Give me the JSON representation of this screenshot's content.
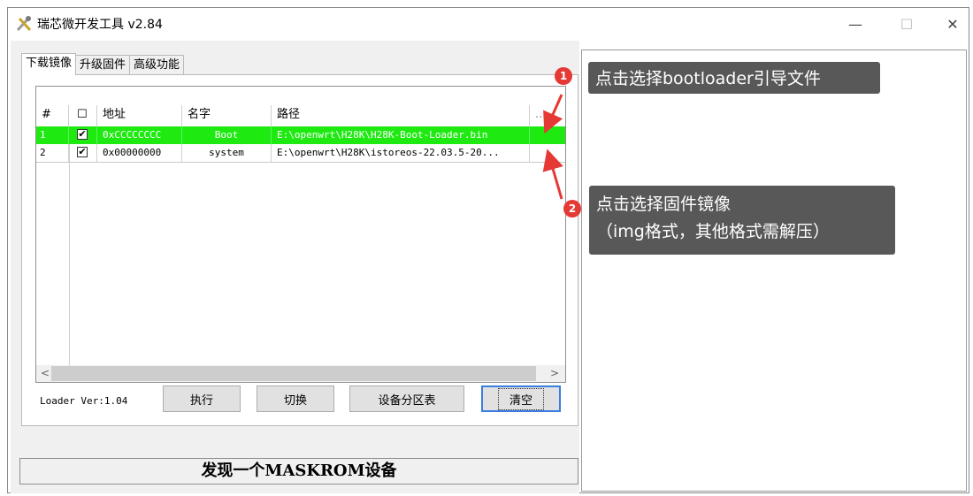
{
  "window": {
    "title": "瑞芯微开发工具 v2.84",
    "minimize": "—",
    "maximize": "☐",
    "close": "✕"
  },
  "tabs": [
    {
      "label": "下载镜像",
      "active": true
    },
    {
      "label": "升级固件",
      "active": false
    },
    {
      "label": "高级功能",
      "active": false
    }
  ],
  "table": {
    "headers": [
      "#",
      "☐",
      "地址",
      "名字",
      "路径",
      "..."
    ],
    "rows": [
      {
        "num": "1",
        "checked": "✔",
        "address": "0xCCCCCCCC",
        "name": "Boot",
        "path": "E:\\openwrt\\H28K\\H28K-Boot-Loader.bin",
        "selected": true
      },
      {
        "num": "2",
        "checked": "✔",
        "address": "0x00000000",
        "name": "system",
        "path": "E:\\openwrt\\H28K\\istoreos-22.03.5-20...",
        "selected": false
      }
    ]
  },
  "scroll": {
    "left": "<",
    "right": ">"
  },
  "footer": {
    "loader_ver": "Loader Ver:1.04",
    "buttons": [
      "执行",
      "切换",
      "设备分区表",
      "清空"
    ]
  },
  "status": "发现一个MASKROM设备",
  "callouts": [
    {
      "badge": "1",
      "text": "点击选择bootloader引导文件"
    },
    {
      "badge": "2",
      "line1": "点击选择固件镜像",
      "line2": "（img格式，其他格式需解压）"
    }
  ],
  "colors": {
    "selected_row": "#1eea12",
    "callout_bg": "#585858",
    "badge": "#e53935",
    "arrow": "#e53935"
  }
}
